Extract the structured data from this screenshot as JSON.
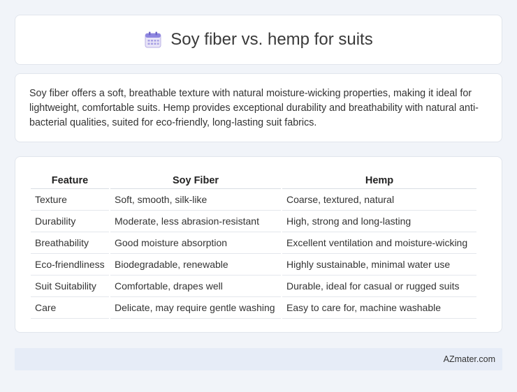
{
  "header": {
    "title": "Soy fiber vs. hemp for suits",
    "icon": "calendar-icon"
  },
  "summary": {
    "text": "Soy fiber offers a soft, breathable texture with natural moisture-wicking properties, making it ideal for lightweight, comfortable suits. Hemp provides exceptional durability and breathability with natural anti-bacterial qualities, suited for eco-friendly, long-lasting suit fabrics."
  },
  "table": {
    "headers": [
      "Feature",
      "Soy Fiber",
      "Hemp"
    ],
    "rows": [
      [
        "Texture",
        "Soft, smooth, silk-like",
        "Coarse, textured, natural"
      ],
      [
        "Durability",
        "Moderate, less abrasion-resistant",
        "High, strong and long-lasting"
      ],
      [
        "Breathability",
        "Good moisture absorption",
        "Excellent ventilation and moisture-wicking"
      ],
      [
        "Eco-friendliness",
        "Biodegradable, renewable",
        "Highly sustainable, minimal water use"
      ],
      [
        "Suit Suitability",
        "Comfortable, drapes well",
        "Durable, ideal for casual or rugged suits"
      ],
      [
        "Care",
        "Delicate, may require gentle washing",
        "Easy to care for, machine washable"
      ]
    ]
  },
  "footer": {
    "text": "AZmater.com"
  }
}
